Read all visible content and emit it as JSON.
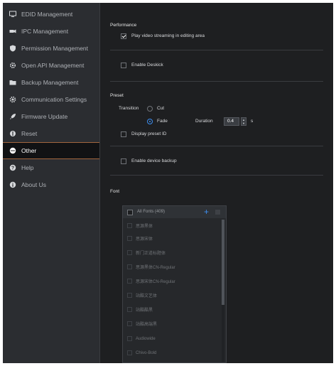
{
  "sidebar": {
    "items": [
      {
        "label": "EDID Management",
        "icon": "monitor-icon"
      },
      {
        "label": "IPC Management",
        "icon": "camera-icon"
      },
      {
        "label": "Permission Management",
        "icon": "shield-icon"
      },
      {
        "label": "Open API Management",
        "icon": "api-gear-icon"
      },
      {
        "label": "Backup Management",
        "icon": "folder-icon"
      },
      {
        "label": "Communication Settings",
        "icon": "gear-icon"
      },
      {
        "label": "Firmware Update",
        "icon": "rocket-icon"
      },
      {
        "label": "Reset",
        "icon": "reset-icon"
      },
      {
        "label": "Other",
        "icon": "other-icon",
        "active": true
      },
      {
        "label": "Help",
        "icon": "help-icon"
      },
      {
        "label": "About Us",
        "icon": "info-icon"
      }
    ]
  },
  "performance": {
    "title": "Performance",
    "play_video_label": "Play video streaming in editing area",
    "play_video_checked": true
  },
  "deskick": {
    "enable_label": "Enable Deskick",
    "checked": false
  },
  "preset": {
    "title": "Preset",
    "transition_label": "Transition",
    "cut_label": "Cut",
    "fade_label": "Fade",
    "selected": "Fade",
    "duration_label": "Duration",
    "duration_value": "0.4",
    "duration_unit": "s",
    "display_id_label": "Display preset ID",
    "display_id_checked": false
  },
  "backup": {
    "enable_label": "Enable device backup",
    "checked": false
  },
  "font": {
    "title": "Font",
    "header_label": "All Fonts (409)",
    "items": [
      "思源黑体",
      "思源宋体",
      "新门正道标题体",
      "思源黑体CN-Regular",
      "思源宋体CN-Regular",
      "站酷文艺体",
      "站酷酷黑",
      "站酷高端黑",
      "Audiowide",
      "Chivo-Bold"
    ]
  },
  "colors": {
    "accent": "#3d8ef0",
    "active_border": "#a2663e",
    "sidebar_bg": "#2b2d31",
    "content_bg": "#1e1f21"
  }
}
